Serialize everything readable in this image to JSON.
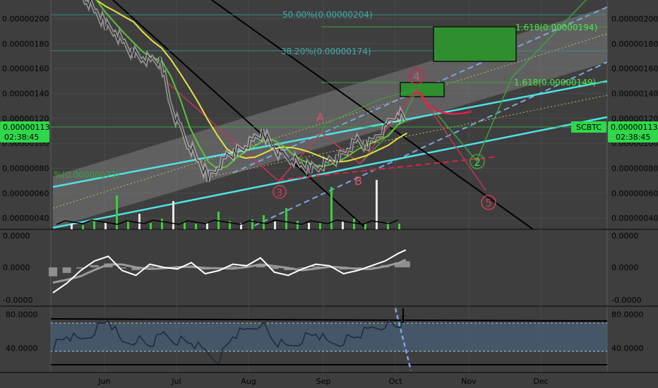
{
  "chart_data": {
    "type": "line",
    "pair": "SCBTC",
    "x_ticks": [
      "Jun",
      "Jul",
      "Aug",
      "Sep",
      "Oct",
      "Nov",
      "Dec"
    ],
    "price_axis": {
      "ticks": [
        "0.00000040",
        "0.00000060",
        "0.00000080",
        "0.00000100",
        "0.00000120",
        "0.00000140",
        "0.00000160",
        "0.00000180",
        "0.00000200"
      ],
      "ylim": [
        3.1e-07,
        2.15e-06
      ],
      "current_price": "0.00000113",
      "countdown": "02:38:45",
      "symbol_label": "SCBTC"
    },
    "fib_levels": [
      {
        "label": "50.00%(0.00000204)",
        "value": 2.04e-06
      },
      {
        "label": "38.20%(0.00000174)",
        "value": 1.74e-06
      },
      {
        "label": "%(0.00000073)",
        "value": 7.3e-07
      }
    ],
    "projections": [
      {
        "label": "1.618(0.00000194)",
        "value": 1.94e-06
      },
      {
        "label": "1.618(0.00000149)",
        "value": 1.49e-06
      }
    ],
    "wave_labels": [
      "A",
      "B",
      "3",
      "4",
      "2",
      "5"
    ],
    "price_series": {
      "x": [
        0.0,
        0.03,
        0.06,
        0.09,
        0.12,
        0.15,
        0.18,
        0.21,
        0.24,
        0.27,
        0.3,
        0.33,
        0.36,
        0.39,
        0.42,
        0.45,
        0.48,
        0.51,
        0.54,
        0.57,
        0.6,
        0.63,
        0.66,
        0.69,
        0.72,
        0.75,
        0.78,
        0.81,
        0.84,
        0.87,
        0.9,
        0.93,
        0.96,
        1.0,
        1.03,
        1.06
      ],
      "y": [
        2.25e-06,
        2.15e-06,
        2.05e-06,
        1.95e-06,
        1.9e-06,
        1.8e-06,
        1.72e-06,
        1.68e-06,
        1.66e-06,
        1.65e-06,
        1.3e-06,
        1.12e-06,
        9.8e-07,
        8.5e-07,
        7.3e-07,
        8.1e-07,
        9e-07,
        9.3e-07,
        9.7e-07,
        1.03e-06,
        1.08e-06,
        9.7e-07,
        9e-07,
        8.8e-07,
        8.2e-07,
        8e-07,
        8.2e-07,
        8.6e-07,
        8.8e-07,
        9.5e-07,
        1.02e-06,
        9.8e-07,
        1.05e-06,
        1.15e-06,
        1.24e-06,
        1.18e-06
      ]
    },
    "oscillator": {
      "ticks": [
        "0.0000",
        "0.0000",
        "-0.0000"
      ],
      "x": [
        0.0,
        0.04,
        0.08,
        0.12,
        0.16,
        0.2,
        0.24,
        0.28,
        0.32,
        0.36,
        0.4,
        0.44,
        0.48,
        0.52,
        0.56,
        0.6,
        0.64,
        0.68,
        0.72,
        0.76,
        0.8,
        0.84,
        0.88,
        0.92,
        0.96,
        1.0,
        1.02
      ],
      "y": [
        -0.8,
        -0.5,
        -0.1,
        0.2,
        0.35,
        -0.1,
        -0.25,
        0.1,
        0.0,
        -0.05,
        0.15,
        -0.2,
        -0.1,
        0.1,
        0.05,
        0.3,
        -0.15,
        -0.25,
        -0.05,
        0.1,
        0.05,
        -0.2,
        -0.1,
        0.05,
        0.2,
        0.45,
        0.55
      ]
    },
    "rsi": {
      "ticks": [
        "80.0000",
        "40.0000"
      ],
      "ylim": [
        12,
        88
      ],
      "band": [
        30,
        70
      ],
      "x": [
        0.0,
        0.04,
        0.08,
        0.12,
        0.16,
        0.2,
        0.24,
        0.28,
        0.32,
        0.36,
        0.4,
        0.44,
        0.48,
        0.52,
        0.56,
        0.6,
        0.64,
        0.68,
        0.72,
        0.76,
        0.8,
        0.84,
        0.88,
        0.92,
        0.96,
        1.0,
        1.02
      ],
      "y": [
        42,
        55,
        48,
        62,
        74,
        45,
        52,
        44,
        56,
        50,
        47,
        35,
        28,
        55,
        60,
        72,
        48,
        40,
        52,
        58,
        44,
        50,
        55,
        62,
        70,
        66,
        78
      ]
    },
    "grid": true
  }
}
